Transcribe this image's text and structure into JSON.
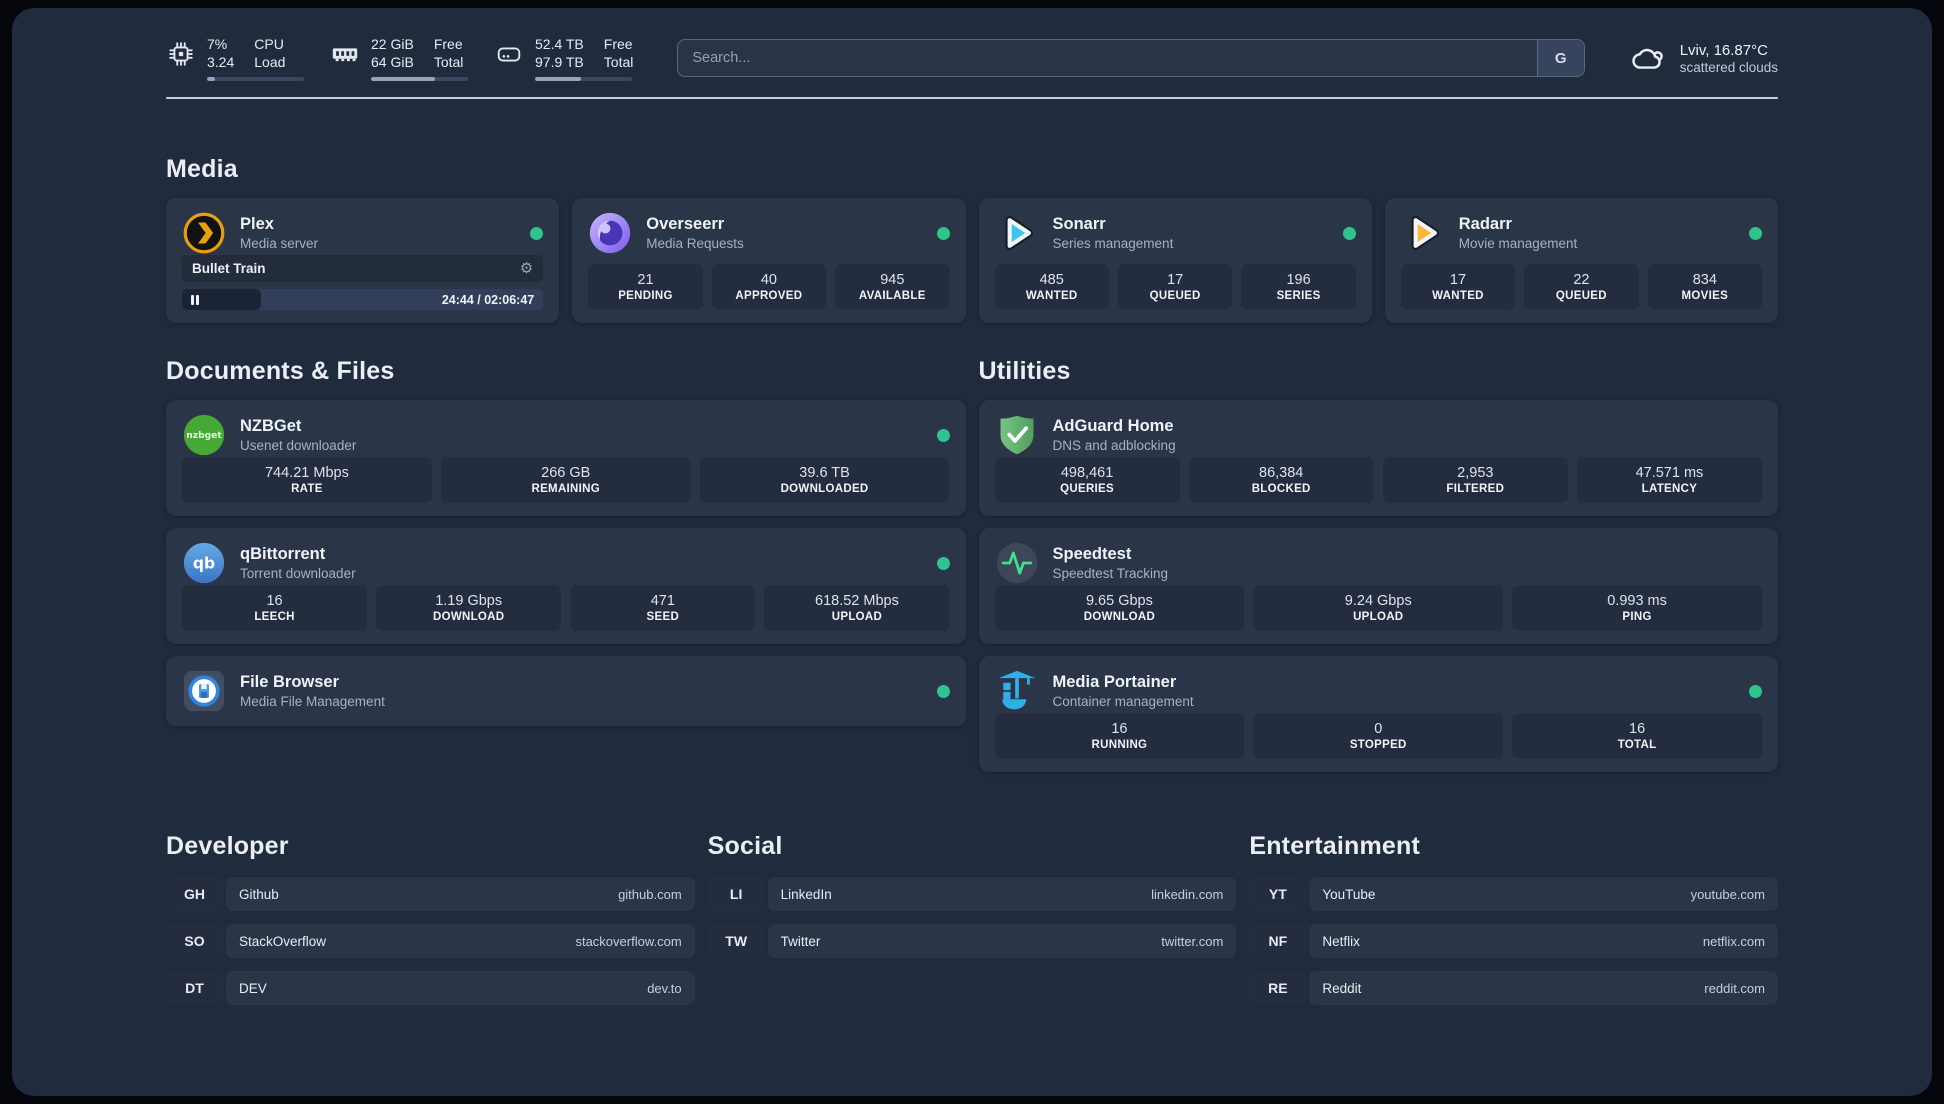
{
  "header": {
    "stats": [
      {
        "icon": "cpu-icon",
        "col1": [
          "7%",
          "3.24"
        ],
        "col2": [
          "CPU",
          "Load"
        ],
        "progress_pct": 8
      },
      {
        "icon": "ram-icon",
        "col1": [
          "22 GiB",
          "64 GiB"
        ],
        "col2": [
          "Free",
          "Total"
        ],
        "progress_pct": 66
      },
      {
        "icon": "disk-icon",
        "col1": [
          "52.4 TB",
          "97.9 TB"
        ],
        "col2": [
          "Free",
          "Total"
        ],
        "progress_pct": 47
      }
    ],
    "search": {
      "placeholder": "Search...",
      "engine_button": "G"
    },
    "weather": {
      "icon": "cloud-icon",
      "location_temp": "Lviv, 16.87°C",
      "condition": "scattered clouds"
    }
  },
  "sections": {
    "media": {
      "title": "Media",
      "apps": [
        {
          "name": "Plex",
          "subtitle": "Media server",
          "icon": "plex-icon",
          "online": true,
          "player": {
            "title": "Bullet Train",
            "time_display": "24:44 / 02:06:47",
            "elapsed": "24:44",
            "duration": "02:06:47",
            "state": "paused",
            "progress_pct": 19.5
          }
        },
        {
          "name": "Overseerr",
          "subtitle": "Media Requests",
          "icon": "overseerr-icon",
          "online": true,
          "stats": [
            {
              "value": "21",
              "label": "PENDING"
            },
            {
              "value": "40",
              "label": "APPROVED"
            },
            {
              "value": "945",
              "label": "AVAILABLE"
            }
          ]
        },
        {
          "name": "Sonarr",
          "subtitle": "Series management",
          "icon": "sonarr-icon",
          "online": true,
          "stats": [
            {
              "value": "485",
              "label": "WANTED"
            },
            {
              "value": "17",
              "label": "QUEUED"
            },
            {
              "value": "196",
              "label": "SERIES"
            }
          ]
        },
        {
          "name": "Radarr",
          "subtitle": "Movie management",
          "icon": "radarr-icon",
          "online": true,
          "stats": [
            {
              "value": "17",
              "label": "WANTED"
            },
            {
              "value": "22",
              "label": "QUEUED"
            },
            {
              "value": "834",
              "label": "MOVIES"
            }
          ]
        }
      ]
    },
    "documents": {
      "title": "Documents & Files",
      "apps": [
        {
          "name": "NZBGet",
          "subtitle": "Usenet downloader",
          "icon": "nzbget-icon",
          "online": true,
          "stats": [
            {
              "value": "744.21 Mbps",
              "label": "RATE"
            },
            {
              "value": "266 GB",
              "label": "REMAINING"
            },
            {
              "value": "39.6 TB",
              "label": "DOWNLOADED"
            }
          ]
        },
        {
          "name": "qBittorrent",
          "subtitle": "Torrent downloader",
          "icon": "qbittorrent-icon",
          "online": true,
          "stats": [
            {
              "value": "16",
              "label": "LEECH"
            },
            {
              "value": "1.19 Gbps",
              "label": "DOWNLOAD"
            },
            {
              "value": "471",
              "label": "SEED"
            },
            {
              "value": "618.52 Mbps",
              "label": "UPLOAD"
            }
          ]
        },
        {
          "name": "File Browser",
          "subtitle": "Media File Management",
          "icon": "filebrowser-icon",
          "online": true,
          "stats": []
        }
      ]
    },
    "utilities": {
      "title": "Utilities",
      "apps": [
        {
          "name": "AdGuard Home",
          "subtitle": "DNS and adblocking",
          "icon": "adguard-icon",
          "online": false,
          "stats": [
            {
              "value": "498,461",
              "label": "QUERIES"
            },
            {
              "value": "86,384",
              "label": "BLOCKED"
            },
            {
              "value": "2,953",
              "label": "FILTERED"
            },
            {
              "value": "47.571 ms",
              "label": "LATENCY"
            }
          ]
        },
        {
          "name": "Speedtest",
          "subtitle": "Speedtest Tracking",
          "icon": "speedtest-icon",
          "online": false,
          "stats": [
            {
              "value": "9.65 Gbps",
              "label": "DOWNLOAD"
            },
            {
              "value": "9.24 Gbps",
              "label": "UPLOAD"
            },
            {
              "value": "0.993 ms",
              "label": "PING"
            }
          ]
        },
        {
          "name": "Media Portainer",
          "subtitle": "Container management",
          "icon": "portainer-icon",
          "online": true,
          "stats": [
            {
              "value": "16",
              "label": "RUNNING"
            },
            {
              "value": "0",
              "label": "STOPPED"
            },
            {
              "value": "16",
              "label": "TOTAL"
            }
          ]
        }
      ]
    },
    "links": [
      {
        "title": "Developer",
        "items": [
          {
            "abbr": "GH",
            "name": "Github",
            "url": "github.com"
          },
          {
            "abbr": "SO",
            "name": "StackOverflow",
            "url": "stackoverflow.com"
          },
          {
            "abbr": "DT",
            "name": "DEV",
            "url": "dev.to"
          }
        ]
      },
      {
        "title": "Social",
        "items": [
          {
            "abbr": "LI",
            "name": "LinkedIn",
            "url": "linkedin.com"
          },
          {
            "abbr": "TW",
            "name": "Twitter",
            "url": "twitter.com"
          }
        ]
      },
      {
        "title": "Entertainment",
        "items": [
          {
            "abbr": "YT",
            "name": "YouTube",
            "url": "youtube.com"
          },
          {
            "abbr": "NF",
            "name": "Netflix",
            "url": "netflix.com"
          },
          {
            "abbr": "RE",
            "name": "Reddit",
            "url": "reddit.com"
          }
        ]
      }
    ]
  },
  "colors": {
    "background": "#212b3e",
    "card": "#2a3547",
    "stat_box": "#232d3f",
    "status_online": "#2ec48b",
    "plex_amber": "#e5a00d",
    "sonarr_cyan": "#3cc5f1",
    "radarr_amber": "#ffb53c",
    "nzbget_green": "#46a835",
    "qbittorrent_blue": "#4a89d4",
    "adguard_green": "#63b272",
    "speedtest_green": "#43e08e",
    "portainer_blue": "#2fb1e8"
  }
}
